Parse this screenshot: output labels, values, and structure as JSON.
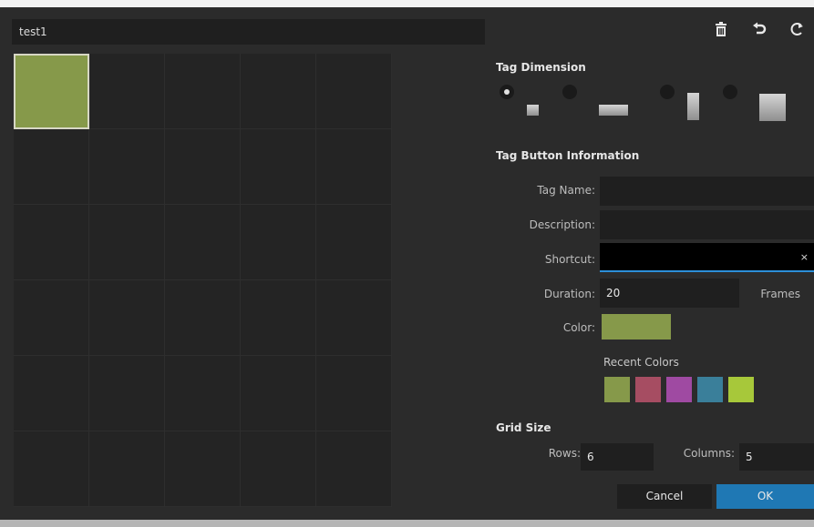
{
  "title": "test1",
  "toolbar": {
    "delete_icon": "trash-icon",
    "undo_icon": "undo-icon",
    "redo_icon": "redo-icon"
  },
  "tag_grid": {
    "filled_cell_color": "#86994a"
  },
  "tag_dimension": {
    "title": "Tag Dimension",
    "options": [
      "small",
      "wide",
      "tall",
      "large"
    ],
    "selected": "small"
  },
  "tag_button_info": {
    "title": "Tag Button Information",
    "tag_name_label": "Tag Name:",
    "tag_name_value": "",
    "description_label": "Description:",
    "description_value": "",
    "shortcut_label": "Shortcut:",
    "shortcut_value": "",
    "clear_glyph": "×",
    "duration_label": "Duration:",
    "duration_value": "20",
    "duration_unit": "Frames",
    "color_label": "Color:",
    "color_value": "#86994a",
    "recent_colors_label": "Recent Colors",
    "recent_colors": [
      "#86994a",
      "#a64d62",
      "#9f4aa2",
      "#3a7f9a",
      "#a7c83a"
    ]
  },
  "grid_size": {
    "title": "Grid Size",
    "rows_label": "Rows:",
    "rows_value": "6",
    "columns_label": "Columns:",
    "columns_value": "5"
  },
  "buttons": {
    "cancel": "Cancel",
    "ok": "OK"
  },
  "colors": {
    "accent_blue": "#1f78b4",
    "focus_underline": "#2c8fd8"
  }
}
